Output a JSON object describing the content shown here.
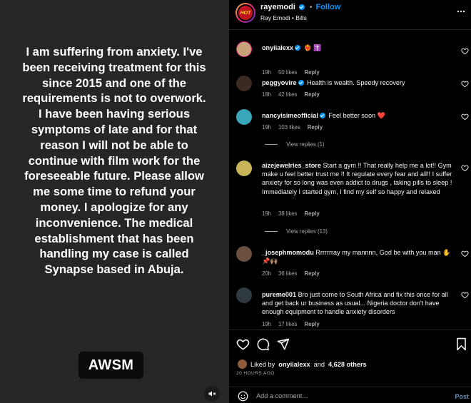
{
  "media": {
    "statement": "I am suffering from anxiety. I've been receiving treatment for this since 2015 and one of the requirements is not to overwork. I have been having serious symptoms of late and for that reason I will not be able to continue with film work for the foreseeable future. Please allow me some time to refund your money. I apologize for any inconvenience. The medical establishment that has been handling my case is called Synapse based in Abuja.",
    "badge": "AWSM",
    "mute_icon": "speaker-muted-icon"
  },
  "header": {
    "avatar_text": "HOT",
    "username": "rayemodi",
    "separator": "•",
    "follow_label": "Follow",
    "subtitle": "Ray Emodi • Bills",
    "more_icon": "more-options-icon"
  },
  "comments": [
    {
      "user": "onyiialexx",
      "verified": true,
      "text": "❤️‍🔥 ✝️",
      "time": "19h",
      "likes": "50 likes",
      "reply": "Reply",
      "avatar_color": "#c8a27a"
    },
    {
      "user": "peggyovire",
      "verified": true,
      "text": "Health is wealth. Speedy recovery",
      "time": "18h",
      "likes": "42 likes",
      "reply": "Reply",
      "avatar_color": "#3a2a22"
    },
    {
      "user": "nancyisimeofficial",
      "verified": true,
      "text": "Feel better soon ❤️",
      "time": "19h",
      "likes": "103 likes",
      "reply": "Reply",
      "view_replies": "View replies (1)",
      "avatar_color": "#3aa6b9"
    },
    {
      "user": "aizejewelries_store",
      "verified": false,
      "text": "Start a gym !! That really help me a lot!! Gym make u feel better trust me !! It regulate every fear and all!! I suffer anxiety for so long was even addict to drugs , taking pills to sleep ! Immediately I started gym, I find my self so happy and relaxed",
      "time": "19h",
      "likes": "38 likes",
      "reply": "Reply",
      "view_replies": "View replies (13)",
      "avatar_color": "#c9b458"
    },
    {
      "user": "_josephmomodu",
      "verified": false,
      "text": "Rrrrrrray my mannnn, God be with you man ✋📌🙌🏽",
      "time": "20h",
      "likes": "36 likes",
      "reply": "Reply",
      "avatar_color": "#6b4f3f"
    },
    {
      "user": "pureme001",
      "verified": false,
      "text": "Bro just come to South Africa and fix this once for all and get back ur business as usual... Nigeria doctor don't have enough equipment to handle anxiety disorders",
      "time": "19h",
      "likes": "17 likes",
      "reply": "Reply",
      "avatar_color": "#2f3a40"
    }
  ],
  "actions": {
    "like_icon": "heart-icon",
    "comment_icon": "comment-icon",
    "share_icon": "share-icon",
    "save_icon": "bookmark-icon",
    "liked_by_prefix": "Liked by",
    "liked_by_user": "onyiialexx",
    "liked_by_and": "and",
    "liked_by_others": "4,628 others",
    "time_ago": "20 HOURS AGO"
  },
  "add_comment": {
    "emoji_icon": "smiley-icon",
    "placeholder": "Add a comment...",
    "post_label": "Post"
  }
}
